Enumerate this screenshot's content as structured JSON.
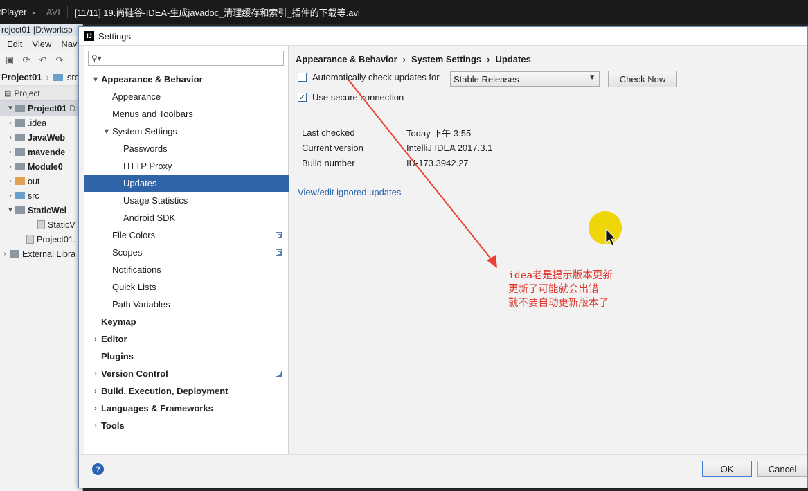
{
  "player": {
    "app_name": "tPlayer",
    "format": "AVI",
    "file_title": "[11/11] 19.尚硅谷-IDEA-生成javadoc_清理缓存和索引_插件的下载等.avi"
  },
  "ide": {
    "window_title": "roject01 [D:\\worksp",
    "menu": [
      "Edit",
      "View",
      "Navi"
    ],
    "breadcrumb": [
      "Project01",
      "src"
    ],
    "project_tab": "Project",
    "tree": [
      {
        "label": "Project01",
        "suffix": "D:",
        "arrow": "▼",
        "icon": "gray",
        "bold": true,
        "selected": true
      },
      {
        "label": ".idea",
        "arrow": "›",
        "icon": "gray"
      },
      {
        "label": "JavaWeb",
        "arrow": "›",
        "icon": "gray",
        "bold": true
      },
      {
        "label": "mavende",
        "arrow": "›",
        "icon": "gray",
        "bold": true
      },
      {
        "label": "Module0",
        "arrow": "›",
        "icon": "gray",
        "bold": true
      },
      {
        "label": "out",
        "arrow": "›",
        "icon": "orange"
      },
      {
        "label": "src",
        "arrow": "›",
        "icon": "blue"
      },
      {
        "label": "StaticWel",
        "arrow": "▼",
        "icon": "gray",
        "bold": true
      },
      {
        "label": "StaticV",
        "arrow": "",
        "icon": "doc",
        "indent": 2
      },
      {
        "label": "Project01.",
        "arrow": "",
        "icon": "doc",
        "indent": 1
      },
      {
        "label": "External Libra",
        "arrow": "›",
        "icon": "gray",
        "indent": -1
      }
    ]
  },
  "dialog": {
    "title": "Settings",
    "search_placeholder": "",
    "nav": [
      {
        "label": "Appearance & Behavior",
        "level": 0,
        "bold": true,
        "chevron": "▼"
      },
      {
        "label": "Appearance",
        "level": 1
      },
      {
        "label": "Menus and Toolbars",
        "level": 1
      },
      {
        "label": "System Settings",
        "level": 1,
        "chevron": "▼"
      },
      {
        "label": "Passwords",
        "level": 2
      },
      {
        "label": "HTTP Proxy",
        "level": 2
      },
      {
        "label": "Updates",
        "level": 2,
        "selected": true
      },
      {
        "label": "Usage Statistics",
        "level": 2
      },
      {
        "label": "Android SDK",
        "level": 2
      },
      {
        "label": "File Colors",
        "level": 1,
        "copy": true
      },
      {
        "label": "Scopes",
        "level": 1,
        "copy": true
      },
      {
        "label": "Notifications",
        "level": 1
      },
      {
        "label": "Quick Lists",
        "level": 1
      },
      {
        "label": "Path Variables",
        "level": 1
      },
      {
        "label": "Keymap",
        "level": 0,
        "bold": true
      },
      {
        "label": "Editor",
        "level": 0,
        "bold": true,
        "chevron": "›"
      },
      {
        "label": "Plugins",
        "level": 0,
        "bold": true
      },
      {
        "label": "Version Control",
        "level": 0,
        "bold": true,
        "chevron": "›",
        "copy": true
      },
      {
        "label": "Build, Execution, Deployment",
        "level": 0,
        "bold": true,
        "chevron": "›"
      },
      {
        "label": "Languages & Frameworks",
        "level": 0,
        "bold": true,
        "chevron": "›"
      },
      {
        "label": "Tools",
        "level": 0,
        "bold": true,
        "chevron": "›"
      }
    ],
    "breadcrumb": [
      "Appearance & Behavior",
      "System Settings",
      "Updates"
    ],
    "auto_check_label": "Automatically check updates for",
    "auto_check_checked": false,
    "channel_value": "Stable Releases",
    "check_now_label": "Check Now",
    "secure_label": "Use secure connection",
    "secure_checked": true,
    "info": [
      {
        "key": "Last checked",
        "value": "Today 下午 3:55"
      },
      {
        "key": "Current version",
        "value": "IntelliJ IDEA 2017.3.1"
      },
      {
        "key": "Build number",
        "value": "IU-173.3942.27"
      }
    ],
    "ignored_link": "View/edit ignored updates",
    "ok_label": "OK",
    "cancel_label": "Cancel",
    "help_label": "?"
  },
  "annotation": {
    "text": "idea老是提示版本更新\n更新了可能就会出错\n就不要自动更新版本了",
    "color": "#e0342a"
  },
  "colors": {
    "selection": "#2f65a8",
    "link": "#2764b0",
    "cursor_highlight": "#eed608"
  }
}
